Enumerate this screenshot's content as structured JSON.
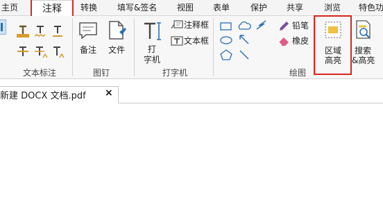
{
  "menu": {
    "items": [
      "主页",
      "注释",
      "转换",
      "填写&签名",
      "视图",
      "表单",
      "保护",
      "共享",
      "浏览",
      "特色功"
    ],
    "active": "注释"
  },
  "ribbon": {
    "groups": {
      "text_markup": "文本标注",
      "pin": "图钉",
      "typewriter": "打字机",
      "drawing": "绘图"
    },
    "buttons": {
      "note": "备注",
      "file": "文件",
      "typewriter_line1": "打",
      "typewriter_line2": "字机",
      "callout": "注释框",
      "textbox": "文本框",
      "pencil": "铅笔",
      "eraser": "橡皮",
      "area_highlight_line1": "区域",
      "area_highlight_line2": "高亮",
      "search_highlight_line1": "搜索",
      "search_highlight_line2": "&高亮"
    }
  },
  "document_tab": {
    "title": "新建 DOCX 文档.pdf",
    "close": "×"
  },
  "colors": {
    "highlight_box": "#d9251d",
    "accent_orange": "#d79b2b",
    "accent_blue": "#2a6fb8",
    "accent_purple": "#7a4fa0"
  }
}
